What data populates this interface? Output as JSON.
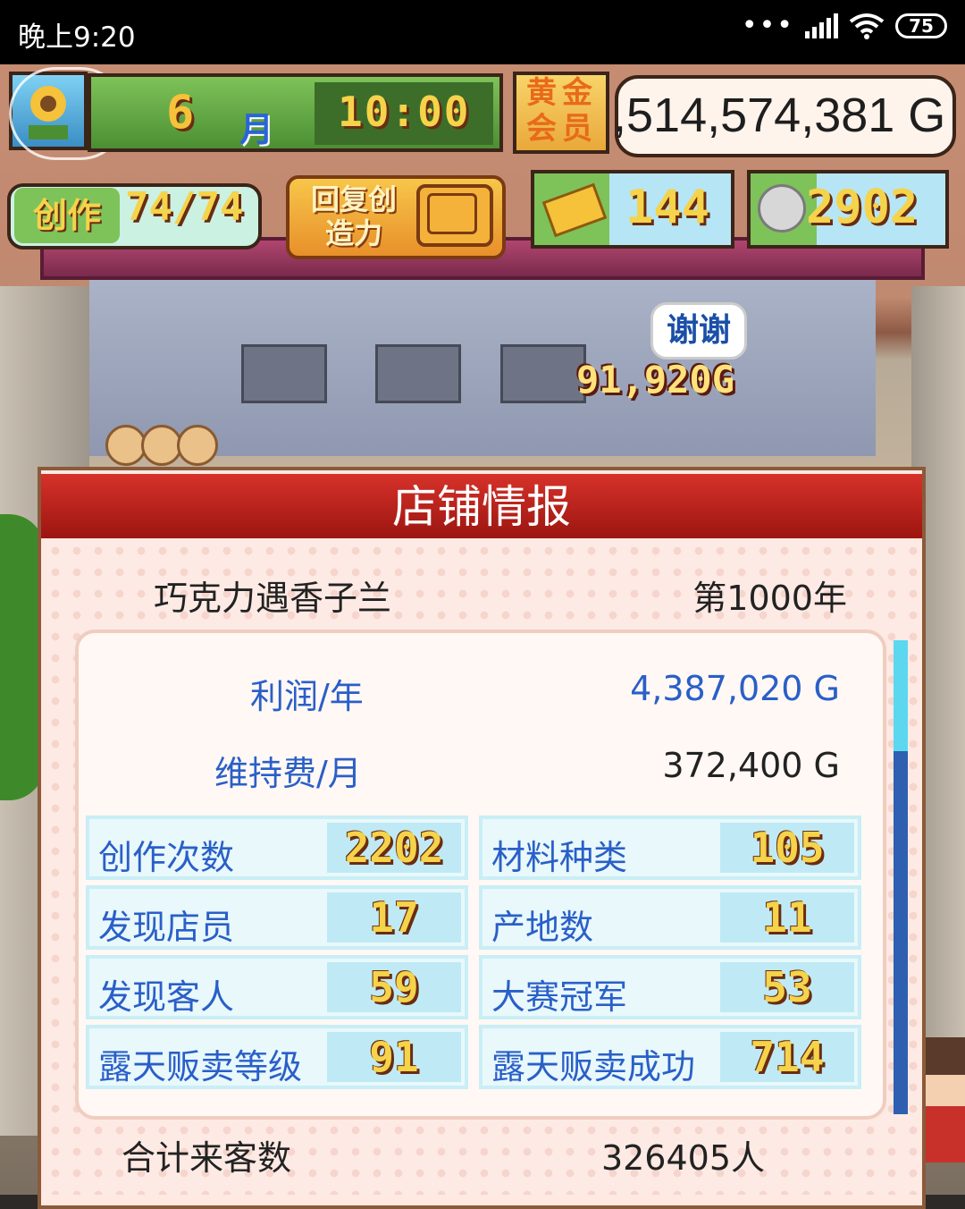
{
  "status_bar": {
    "time": "晚上9:20",
    "battery": "75",
    "signal_dots": "•••"
  },
  "hud": {
    "month_number": "6",
    "month_unit": "月",
    "clock": "10:00",
    "gold_member_label": "黄金会员",
    "money": ",514,574,381 G",
    "create_label": "创作",
    "create_value": "74/74",
    "recover_label": "回复创造力",
    "tickets": "144",
    "medals": "2902"
  },
  "scene": {
    "thanks_bubble": "谢谢",
    "floating_money": "91,920G"
  },
  "panel": {
    "title": "店铺情报",
    "shop_name": "巧克力遇香子兰",
    "year": "第1000年",
    "profit_label": "利润/年",
    "profit_value": "4,387,020 G",
    "upkeep_label": "维持费/月",
    "upkeep_value": "372,400 G",
    "stats": [
      {
        "label": "创作次数",
        "value": "2202"
      },
      {
        "label": "材料种类",
        "value": "105"
      },
      {
        "label": "发现店员",
        "value": "17"
      },
      {
        "label": "产地数",
        "value": "11"
      },
      {
        "label": "发现客人",
        "value": "59"
      },
      {
        "label": "大赛冠军",
        "value": "53"
      },
      {
        "label": "露天贩卖等级",
        "value": "91"
      },
      {
        "label": "露天贩卖成功",
        "value": "714"
      }
    ],
    "total_label": "合计来客数",
    "total_value": "326405人"
  },
  "colors": {
    "accent_red": "#d6322a",
    "label_blue": "#2a5fc8",
    "pixel_gold": "#f5d34a"
  }
}
